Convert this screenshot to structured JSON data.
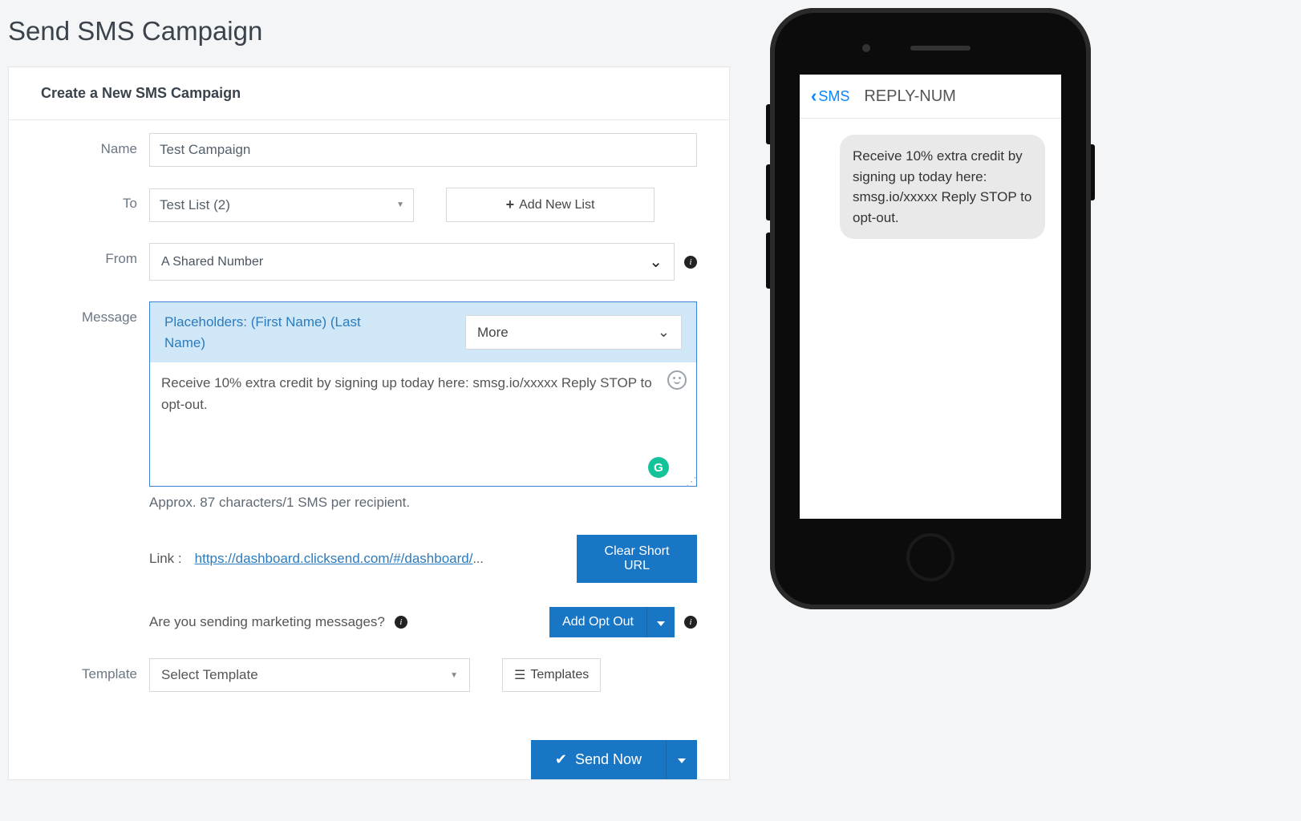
{
  "page": {
    "title": "Send SMS Campaign"
  },
  "card": {
    "header": "Create a New SMS Campaign"
  },
  "labels": {
    "name": "Name",
    "to": "To",
    "from": "From",
    "message": "Message",
    "template": "Template"
  },
  "form": {
    "name_value": "Test Campaign",
    "to_selected": "Test List (2)",
    "add_new_list": "Add New List",
    "from_selected": "A Shared Number",
    "placeholders_label": "Placeholders: (First Name) (Last Name)",
    "more_label": "More",
    "message_value": "Receive 10% extra credit by signing up today here: smsg.io/xxxxx Reply STOP to opt-out.",
    "approx": "Approx. 87 characters/1 SMS per recipient.",
    "link_label": "Link : ",
    "link_url": "https://dashboard.clicksend.com/#/dashboard/",
    "link_trail": "...",
    "clear_short_url": "Clear Short URL",
    "marketing_q": "Are you sending marketing messages? ",
    "add_opt_out": "Add Opt Out",
    "template_selected": "Select Template",
    "templates_btn": "Templates",
    "send_now": "Send Now"
  },
  "preview": {
    "back_label": "SMS",
    "title": "REPLY-NUM",
    "bubble": "Receive 10% extra credit by signing up today here: smsg.io/xxxxx Reply STOP to opt-out."
  }
}
